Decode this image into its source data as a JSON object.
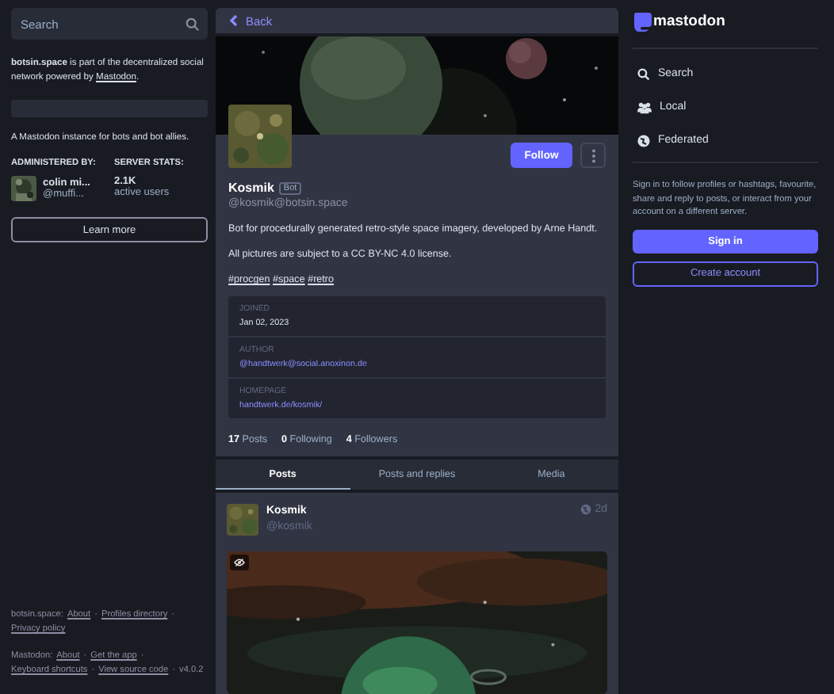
{
  "left": {
    "search": {
      "placeholder": "Search"
    },
    "about": {
      "text": "**botsin.space** is part of the decentralized social network powered by",
      "link": "Mastodon",
      "end": "."
    },
    "description": "A Mastodon instance for bots and bot allies.",
    "admin": {
      "label": "ADMINISTERED BY:",
      "name": "colin mi...",
      "handle": "@muffi..."
    },
    "stats": {
      "label": "SERVER STATS:",
      "value": "2.1K",
      "caption": "active users"
    },
    "learn_more": "Learn more",
    "footer": [
      {
        "label": "botsin.space:",
        "links": [
          "About",
          "Profiles directory",
          "Privacy policy"
        ]
      },
      {
        "label": "Mastodon:",
        "links": [
          "About",
          "Get the app",
          "Keyboard shortcuts",
          "View source code"
        ],
        "version": "v4.0.2"
      }
    ],
    "separator": "·"
  },
  "center": {
    "back": "Back",
    "profile": {
      "name": "Kosmik",
      "badge": "Bot",
      "handle": "@kosmik@botsin.space",
      "follow": "Follow",
      "bio": [
        "Bot for procedurally generated retro-style space imagery, developed by Arne Handt.",
        "All pictures are subject to a CC BY-NC 4.0 license."
      ],
      "tags": [
        "#procgen",
        "#space",
        "#retro"
      ],
      "fields": [
        {
          "label": "JOINED",
          "value": "Jan 02, 2023",
          "kind": "text"
        },
        {
          "label": "AUTHOR",
          "value": "@handtwerk@social.anoxinon.de",
          "kind": "link"
        },
        {
          "label": "HOMEPAGE",
          "value": "handtwerk.de/kosmik/",
          "kind": "link"
        }
      ],
      "counts": [
        {
          "number": "17",
          "label": "Posts"
        },
        {
          "number": "0",
          "label": "Following"
        },
        {
          "number": "4",
          "label": "Followers"
        }
      ]
    },
    "tabs": [
      {
        "label": "Posts",
        "selected": true
      },
      {
        "label": "Posts and replies",
        "selected": false
      },
      {
        "label": "Media",
        "selected": false
      }
    ],
    "post": {
      "name": "Kosmik",
      "handle": "@kosmik",
      "time": "2d"
    }
  },
  "right": {
    "logo": "mastodon",
    "nav": [
      {
        "label": "Search",
        "kind": "search"
      },
      {
        "label": "Local",
        "kind": "local"
      },
      {
        "label": "Federated",
        "kind": "federated"
      }
    ],
    "sign_in_text": "Sign in to follow profiles or hashtags, favourite, share and reply to posts, or interact from your account on a different server.",
    "sign_in": "Sign in",
    "create_account": "Create account"
  }
}
